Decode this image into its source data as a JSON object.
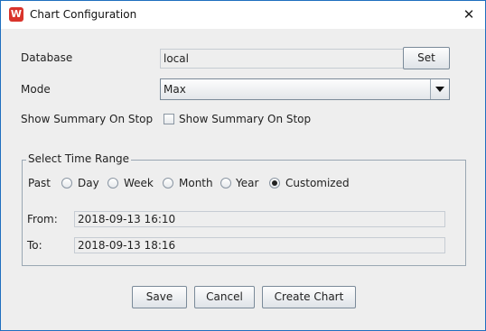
{
  "window": {
    "title": "Chart Configuration",
    "close_glyph": "✕",
    "icon": "app-icon"
  },
  "database": {
    "label": "Database",
    "value": "local",
    "set_label": "Set"
  },
  "mode": {
    "label": "Mode",
    "value": "Max"
  },
  "summary": {
    "label": "Show Summary On Stop",
    "checkbox_label": "Show Summary On Stop",
    "checked": false
  },
  "time_range": {
    "legend": "Select Time Range",
    "past_label": "Past",
    "options": [
      {
        "label": "Day",
        "selected": false
      },
      {
        "label": "Week",
        "selected": false
      },
      {
        "label": "Month",
        "selected": false
      },
      {
        "label": "Year",
        "selected": false
      },
      {
        "label": "Customized",
        "selected": true
      }
    ],
    "from_label": "From:",
    "from_value": "2018-09-13  16:10",
    "to_label": "To:",
    "to_value": "2018-09-13  18:16"
  },
  "buttons": {
    "save": "Save",
    "cancel": "Cancel",
    "create_chart": "Create Chart"
  }
}
